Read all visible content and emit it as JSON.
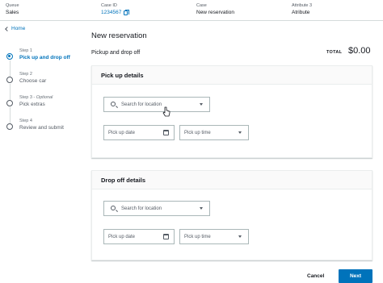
{
  "topbar": {
    "queue": {
      "label": "Queue",
      "value": "Sales"
    },
    "case_id": {
      "label": "Case ID",
      "value": "1234567"
    },
    "case": {
      "label": "Case",
      "value": "New reservation"
    },
    "attribute": {
      "label": "Attribute 3",
      "value": "Atribute"
    }
  },
  "nav": {
    "home_label": "Home",
    "steps": [
      {
        "num": "Step 1",
        "optional": "",
        "title": "Pick up and drop off",
        "active": true
      },
      {
        "num": "Step 2",
        "optional": "",
        "title": "Choose car",
        "active": false
      },
      {
        "num": "Step 3 - ",
        "optional": "Optional",
        "title": "Pick extras",
        "active": false
      },
      {
        "num": "Step 4",
        "optional": "",
        "title": "Review and submit",
        "active": false
      }
    ]
  },
  "main": {
    "title": "New reservation",
    "subtitle": "Pickup and drop off",
    "total_label": "TOTAL",
    "total_value": "$0.00",
    "pickup": {
      "header": "Pick up details",
      "location_placeholder": "Search for location",
      "date_placeholder": "Pick up date",
      "time_placeholder": "Pick up time"
    },
    "dropoff": {
      "header": "Drop off details",
      "location_placeholder": "Search for location",
      "date_placeholder": "Pick up date",
      "time_placeholder": "Pick up time"
    }
  },
  "footer": {
    "cancel_label": "Cancel",
    "next_label": "Next"
  },
  "colors": {
    "accent": "#0073bb",
    "text": "#16191f",
    "border": "#aab7b8"
  },
  "icons": [
    "copy-icon",
    "chevron-left-icon",
    "search-icon",
    "caret-down-icon",
    "calendar-icon",
    "cursor-icon"
  ]
}
